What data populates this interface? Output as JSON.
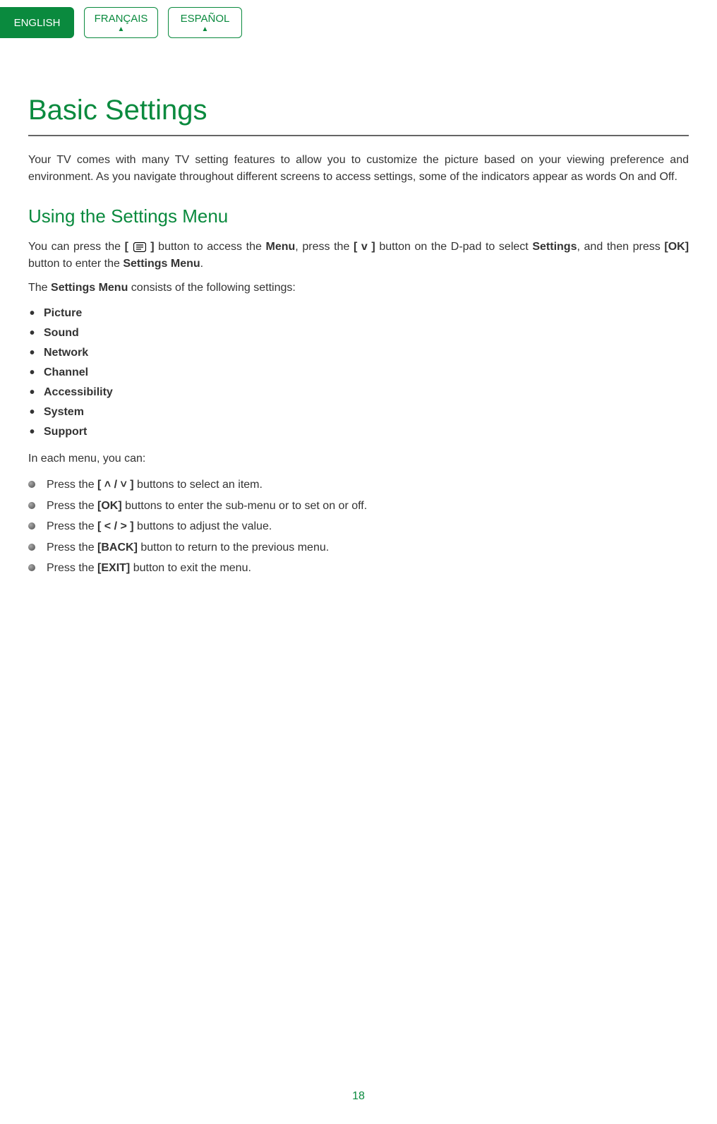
{
  "tabs": {
    "english": "ENGLISH",
    "francais": "FRANÇAIS",
    "espanol": "ESPAÑOL"
  },
  "title": "Basic Settings",
  "intro": "Your TV comes with many TV setting features to allow you to customize the picture based on your viewing preference and environment. As you navigate throughout different screens to access settings, some of the indicators appear as words On and Off.",
  "subtitle": "Using the Settings Menu",
  "p1_a": "You can press the ",
  "p1_b": "[ ",
  "p1_c": " ]",
  "p1_d": " button to access the ",
  "p1_menu": "Menu",
  "p1_e": ", press the ",
  "p1_v": "[ v ]",
  "p1_f": " button on the D-pad to select ",
  "p1_settings": "Settings",
  "p1_g": ", and then press ",
  "p1_ok": "[OK]",
  "p1_h": " button to enter the ",
  "p1_sm": "Settings Menu",
  "p1_i": ".",
  "p2_a": "The ",
  "p2_b": "Settings Menu",
  "p2_c": " consists of the following settings:",
  "menu_items": {
    "0": "Picture",
    "1": "Sound",
    "2": "Network",
    "3": "Channel",
    "4": "Accessibility",
    "5": "System",
    "6": "Support"
  },
  "p3": "In each menu, you can:",
  "actions": {
    "0": {
      "pre": "Press the ",
      "key": "[ ˄ / ˅ ]",
      "post": " buttons to select an item."
    },
    "1": {
      "pre": "Press the ",
      "key": "[OK]",
      "post": " buttons to enter the sub-menu or to set on or off."
    },
    "2": {
      "pre": "Press the ",
      "key": "[ < / > ]",
      "post": " buttons to adjust the value."
    },
    "3": {
      "pre": "Press the ",
      "key": "[BACK]",
      "post": " button to return to the previous menu."
    },
    "4": {
      "pre": "Press the ",
      "key": "[EXIT]",
      "post": " button to exit the menu."
    }
  },
  "page_number": "18"
}
